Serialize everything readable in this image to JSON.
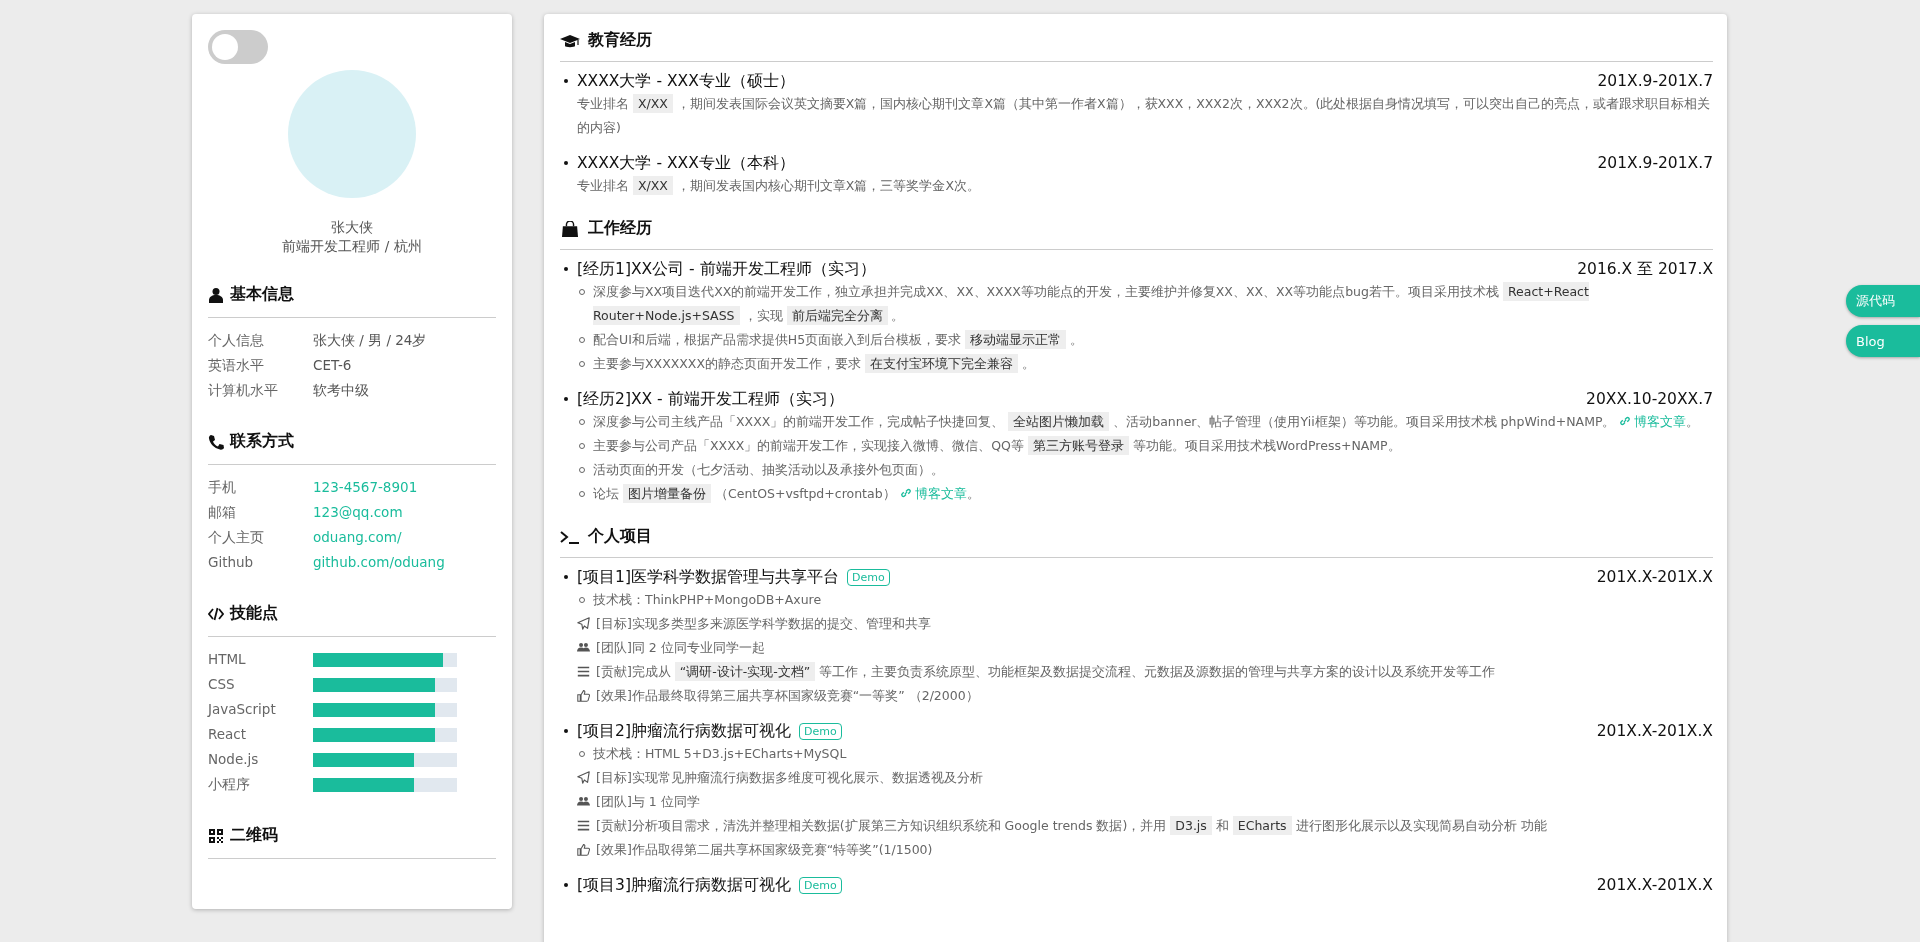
{
  "toggle": {
    "on": false
  },
  "profile": {
    "name": "张大侠",
    "title": "前端开发工程师 / 杭州"
  },
  "sidebar": [
    {
      "kind": "info",
      "title": "基本信息",
      "rows": [
        {
          "label": "个人信息",
          "value": "张大侠 / 男 / 24岁"
        },
        {
          "label": "英语水平",
          "value": "CET-6"
        },
        {
          "label": "计算机水平",
          "value": "软考中级"
        }
      ]
    },
    {
      "kind": "links",
      "title": "联系方式",
      "rows": [
        {
          "label": "手机",
          "value": "123-4567-8901"
        },
        {
          "label": "邮箱",
          "value": "123@qq.com"
        },
        {
          "label": "个人主页",
          "value": "oduang.com/"
        },
        {
          "label": "Github",
          "value": "github.com/oduang"
        }
      ]
    },
    {
      "kind": "skills",
      "title": "技能点",
      "skills": [
        {
          "name": "HTML",
          "level": 0.9
        },
        {
          "name": "CSS",
          "level": 0.85
        },
        {
          "name": "JavaScript",
          "level": 0.85
        },
        {
          "name": "React",
          "level": 0.85
        },
        {
          "name": "Node.js",
          "level": 0.7
        },
        {
          "name": "小程序",
          "level": 0.7
        }
      ]
    },
    {
      "kind": "qrcode",
      "title": "二维码"
    }
  ],
  "sections": [
    {
      "title": "教育经历",
      "entries": [
        {
          "title": "XXXX大学 - XXX专业（硕士）",
          "date": "201X.9-201X.7",
          "description": [
            {
              "kind": "text",
              "text": "专业排名 "
            },
            {
              "kind": "code",
              "text": "X/XX"
            },
            {
              "kind": "text",
              "text": " ，期间发表国际会议英文摘要X篇，国内核心期刊文章X篇（其中第一作者X篇），获XXX，XXX2次，XXX2次。(此处根据自身情况填写，可以突出自己的亮点，或者跟求职目标相关的内容)"
            }
          ]
        },
        {
          "title": "XXXX大学 - XXX专业（本科）",
          "date": "201X.9-201X.7",
          "description": [
            {
              "kind": "text",
              "text": "专业排名 "
            },
            {
              "kind": "code",
              "text": "X/XX"
            },
            {
              "kind": "text",
              "text": " ，期间发表国内核心期刊文章X篇，三等奖学金X次。"
            }
          ]
        }
      ]
    },
    {
      "title": "工作经历",
      "entries": [
        {
          "title": "[经历1]XX公司 - 前端开发工程师（实习）",
          "date": "2016.X 至 2017.X",
          "details": [
            {
              "kind": "bullet",
              "parts": [
                {
                  "kind": "text",
                  "text": "深度参与XX项目迭代XX的前端开发工作，独立承担并完成XX、XX、XXXX等功能点的开发，主要维护并修复XX、XX、XX等功能点bug若干。项目采用技术栈 "
                },
                {
                  "kind": "code",
                  "text": "React+React Router+Node.js+SASS"
                },
                {
                  "kind": "text",
                  "text": " ，实现 "
                },
                {
                  "kind": "code",
                  "text": "前后端完全分离"
                },
                {
                  "kind": "text",
                  "text": " 。"
                }
              ]
            },
            {
              "kind": "bullet",
              "parts": [
                {
                  "kind": "text",
                  "text": "配合UI和后端，根据产品需求提供H5页面嵌入到后台模板，要求 "
                },
                {
                  "kind": "code",
                  "text": "移动端显示正常"
                },
                {
                  "kind": "text",
                  "text": " 。"
                }
              ]
            },
            {
              "kind": "bullet",
              "parts": [
                {
                  "kind": "text",
                  "text": "主要参与XXXXXXX的静态页面开发工作，要求 "
                },
                {
                  "kind": "code",
                  "text": "在支付宝环境下完全兼容"
                },
                {
                  "kind": "text",
                  "text": " 。"
                }
              ]
            }
          ]
        },
        {
          "title": "[经历2]XX - 前端开发工程师（实习）",
          "date": "20XX.10-20XX.7",
          "details": [
            {
              "kind": "bullet",
              "parts": [
                {
                  "kind": "text",
                  "text": "深度参与公司主线产品「XXXX」的前端开发工作，完成帖子快捷回复、 "
                },
                {
                  "kind": "code",
                  "text": "全站图片懒加载"
                },
                {
                  "kind": "text",
                  "text": " 、活动banner、帖子管理（使用Yii框架）等功能。项目采用技术栈 phpWind+NAMP。 "
                },
                {
                  "kind": "link",
                  "text": "博客文章"
                },
                {
                  "kind": "text",
                  "text": "。"
                }
              ]
            },
            {
              "kind": "bullet",
              "parts": [
                {
                  "kind": "text",
                  "text": "主要参与公司产品「XXXX」的前端开发工作，实现接入微博、微信、QQ等 "
                },
                {
                  "kind": "code",
                  "text": "第三方账号登录"
                },
                {
                  "kind": "text",
                  "text": " 等功能。项目采用技术栈WordPress+NAMP。"
                }
              ]
            },
            {
              "kind": "bullet",
              "parts": [
                {
                  "kind": "text",
                  "text": "活动页面的开发（七夕活动、抽奖活动以及承接外包页面）。"
                }
              ]
            },
            {
              "kind": "bullet",
              "parts": [
                {
                  "kind": "text",
                  "text": "论坛 "
                },
                {
                  "kind": "code",
                  "text": "图片增量备份"
                },
                {
                  "kind": "text",
                  "text": " （CentOS+vsftpd+crontab） "
                },
                {
                  "kind": "link",
                  "text": "博客文章"
                },
                {
                  "kind": "text",
                  "text": "。"
                }
              ]
            }
          ]
        }
      ]
    },
    {
      "title": "个人项目",
      "entries": [
        {
          "title": "[项目1]医学科学数据管理与共享平台",
          "badge": "Demo",
          "date": "201X.X-201X.X",
          "details": [
            {
              "kind": "bullet",
              "parts": [
                {
                  "kind": "text",
                  "text": "技术栈：ThinkPHP+MongoDB+Axure"
                }
              ]
            },
            {
              "kind": "plane",
              "parts": [
                {
                  "kind": "text",
                  "text": "[目标]实现多类型多来源医学科学数据的提交、管理和共享"
                }
              ]
            },
            {
              "kind": "users",
              "parts": [
                {
                  "kind": "text",
                  "text": "[团队]同 2 位同专业同学一起"
                }
              ]
            },
            {
              "kind": "list",
              "parts": [
                {
                  "kind": "text",
                  "text": "[贡献]完成从 "
                },
                {
                  "kind": "code",
                  "text": "“调研-设计-实现-文档”"
                },
                {
                  "kind": "text",
                  "text": " 等工作，主要负责系统原型、功能框架及数据提交流程、元数据及源数据的管理与共享方案的设计以及系统开发等工作"
                }
              ]
            },
            {
              "kind": "thumb",
              "parts": [
                {
                  "kind": "text",
                  "text": "[效果]作品最终取得第三届共享杯国家级竞赛“一等奖” （2/2000）"
                }
              ]
            }
          ]
        },
        {
          "title": "[项目2]肿瘤流行病数据可视化",
          "badge": "Demo",
          "date": "201X.X-201X.X",
          "details": [
            {
              "kind": "bullet",
              "parts": [
                {
                  "kind": "text",
                  "text": "技术栈：HTML 5+D3.js+ECharts+MySQL"
                }
              ]
            },
            {
              "kind": "plane",
              "parts": [
                {
                  "kind": "text",
                  "text": "[目标]实现常见肿瘤流行病数据多维度可视化展示、数据透视及分析"
                }
              ]
            },
            {
              "kind": "users",
              "parts": [
                {
                  "kind": "text",
                  "text": "[团队]与 1 位同学"
                }
              ]
            },
            {
              "kind": "list",
              "parts": [
                {
                  "kind": "text",
                  "text": "[贡献]分析项目需求，清洗并整理相关数据(扩展第三方知识组织系统和 Google trends 数据)，并用 "
                },
                {
                  "kind": "code",
                  "text": "D3.js"
                },
                {
                  "kind": "text",
                  "text": " 和 "
                },
                {
                  "kind": "code",
                  "text": "ECharts"
                },
                {
                  "kind": "text",
                  "text": " 进行图形化展示以及实现简易自动分析 功能"
                }
              ]
            },
            {
              "kind": "thumb",
              "parts": [
                {
                  "kind": "text",
                  "text": "[效果]作品取得第二届共享杯国家级竞赛“特等奖”(1/1500)"
                }
              ]
            }
          ]
        },
        {
          "title": "[项目3]肿瘤流行病数据可视化",
          "badge": "Demo",
          "date": "201X.X-201X.X"
        }
      ]
    }
  ],
  "side_tabs": [
    {
      "label": "源代码"
    },
    {
      "label": "Blog"
    }
  ]
}
